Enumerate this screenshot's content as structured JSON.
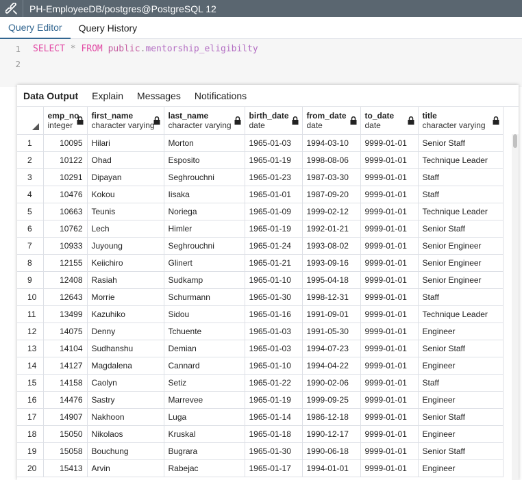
{
  "window": {
    "title": "PH-EmployeeDB/postgres@PostgreSQL 12"
  },
  "editor_tabs": [
    "Query Editor",
    "Query History"
  ],
  "editor": {
    "lines": [
      {
        "num": "1",
        "kw1": "SELECT",
        "star": "*",
        "kw2": "FROM",
        "schema": "public",
        "dot": ".",
        "table": "mentorship_eligibilty"
      },
      {
        "num": "2"
      }
    ]
  },
  "output_tabs": [
    "Data Output",
    "Explain",
    "Messages",
    "Notifications"
  ],
  "columns": [
    {
      "name": "emp_no",
      "type": "integer"
    },
    {
      "name": "first_name",
      "type": "character varying"
    },
    {
      "name": "last_name",
      "type": "character varying"
    },
    {
      "name": "birth_date",
      "type": "date"
    },
    {
      "name": "from_date",
      "type": "date"
    },
    {
      "name": "to_date",
      "type": "date"
    },
    {
      "name": "title",
      "type": "character varying"
    }
  ],
  "rows": [
    [
      "1",
      "10095",
      "Hilari",
      "Morton",
      "1965-01-03",
      "1994-03-10",
      "9999-01-01",
      "Senior Staff"
    ],
    [
      "2",
      "10122",
      "Ohad",
      "Esposito",
      "1965-01-19",
      "1998-08-06",
      "9999-01-01",
      "Technique Leader"
    ],
    [
      "3",
      "10291",
      "Dipayan",
      "Seghrouchni",
      "1965-01-23",
      "1987-03-30",
      "9999-01-01",
      "Staff"
    ],
    [
      "4",
      "10476",
      "Kokou",
      "Iisaka",
      "1965-01-01",
      "1987-09-20",
      "9999-01-01",
      "Staff"
    ],
    [
      "5",
      "10663",
      "Teunis",
      "Noriega",
      "1965-01-09",
      "1999-02-12",
      "9999-01-01",
      "Technique Leader"
    ],
    [
      "6",
      "10762",
      "Lech",
      "Himler",
      "1965-01-19",
      "1992-01-21",
      "9999-01-01",
      "Senior Staff"
    ],
    [
      "7",
      "10933",
      "Juyoung",
      "Seghrouchni",
      "1965-01-24",
      "1993-08-02",
      "9999-01-01",
      "Senior Engineer"
    ],
    [
      "8",
      "12155",
      "Keiichiro",
      "Glinert",
      "1965-01-21",
      "1993-09-16",
      "9999-01-01",
      "Senior Engineer"
    ],
    [
      "9",
      "12408",
      "Rasiah",
      "Sudkamp",
      "1965-01-10",
      "1995-04-18",
      "9999-01-01",
      "Senior Engineer"
    ],
    [
      "10",
      "12643",
      "Morrie",
      "Schurmann",
      "1965-01-30",
      "1998-12-31",
      "9999-01-01",
      "Staff"
    ],
    [
      "11",
      "13499",
      "Kazuhiko",
      "Sidou",
      "1965-01-16",
      "1991-09-01",
      "9999-01-01",
      "Technique Leader"
    ],
    [
      "12",
      "14075",
      "Denny",
      "Tchuente",
      "1965-01-03",
      "1991-05-30",
      "9999-01-01",
      "Engineer"
    ],
    [
      "13",
      "14104",
      "Sudhanshu",
      "Demian",
      "1965-01-03",
      "1994-07-23",
      "9999-01-01",
      "Senior Staff"
    ],
    [
      "14",
      "14127",
      "Magdalena",
      "Cannard",
      "1965-01-10",
      "1994-04-22",
      "9999-01-01",
      "Engineer"
    ],
    [
      "15",
      "14158",
      "Caolyn",
      "Setiz",
      "1965-01-22",
      "1990-02-06",
      "9999-01-01",
      "Staff"
    ],
    [
      "16",
      "14476",
      "Sastry",
      "Marrevee",
      "1965-01-19",
      "1999-09-25",
      "9999-01-01",
      "Engineer"
    ],
    [
      "17",
      "14907",
      "Nakhoon",
      "Luga",
      "1965-01-14",
      "1986-12-18",
      "9999-01-01",
      "Senior Staff"
    ],
    [
      "18",
      "15050",
      "Nikolaos",
      "Kruskal",
      "1965-01-18",
      "1990-12-17",
      "9999-01-01",
      "Engineer"
    ],
    [
      "19",
      "15058",
      "Bouchung",
      "Bugrara",
      "1965-01-30",
      "1990-06-18",
      "9999-01-01",
      "Senior Staff"
    ],
    [
      "20",
      "15413",
      "Arvin",
      "Rabejac",
      "1965-01-17",
      "1994-01-01",
      "9999-01-01",
      "Engineer"
    ]
  ],
  "colors": {
    "titlebar_bg": "#5a6670",
    "accent": "#326690",
    "keyword": "#e24ba5"
  }
}
